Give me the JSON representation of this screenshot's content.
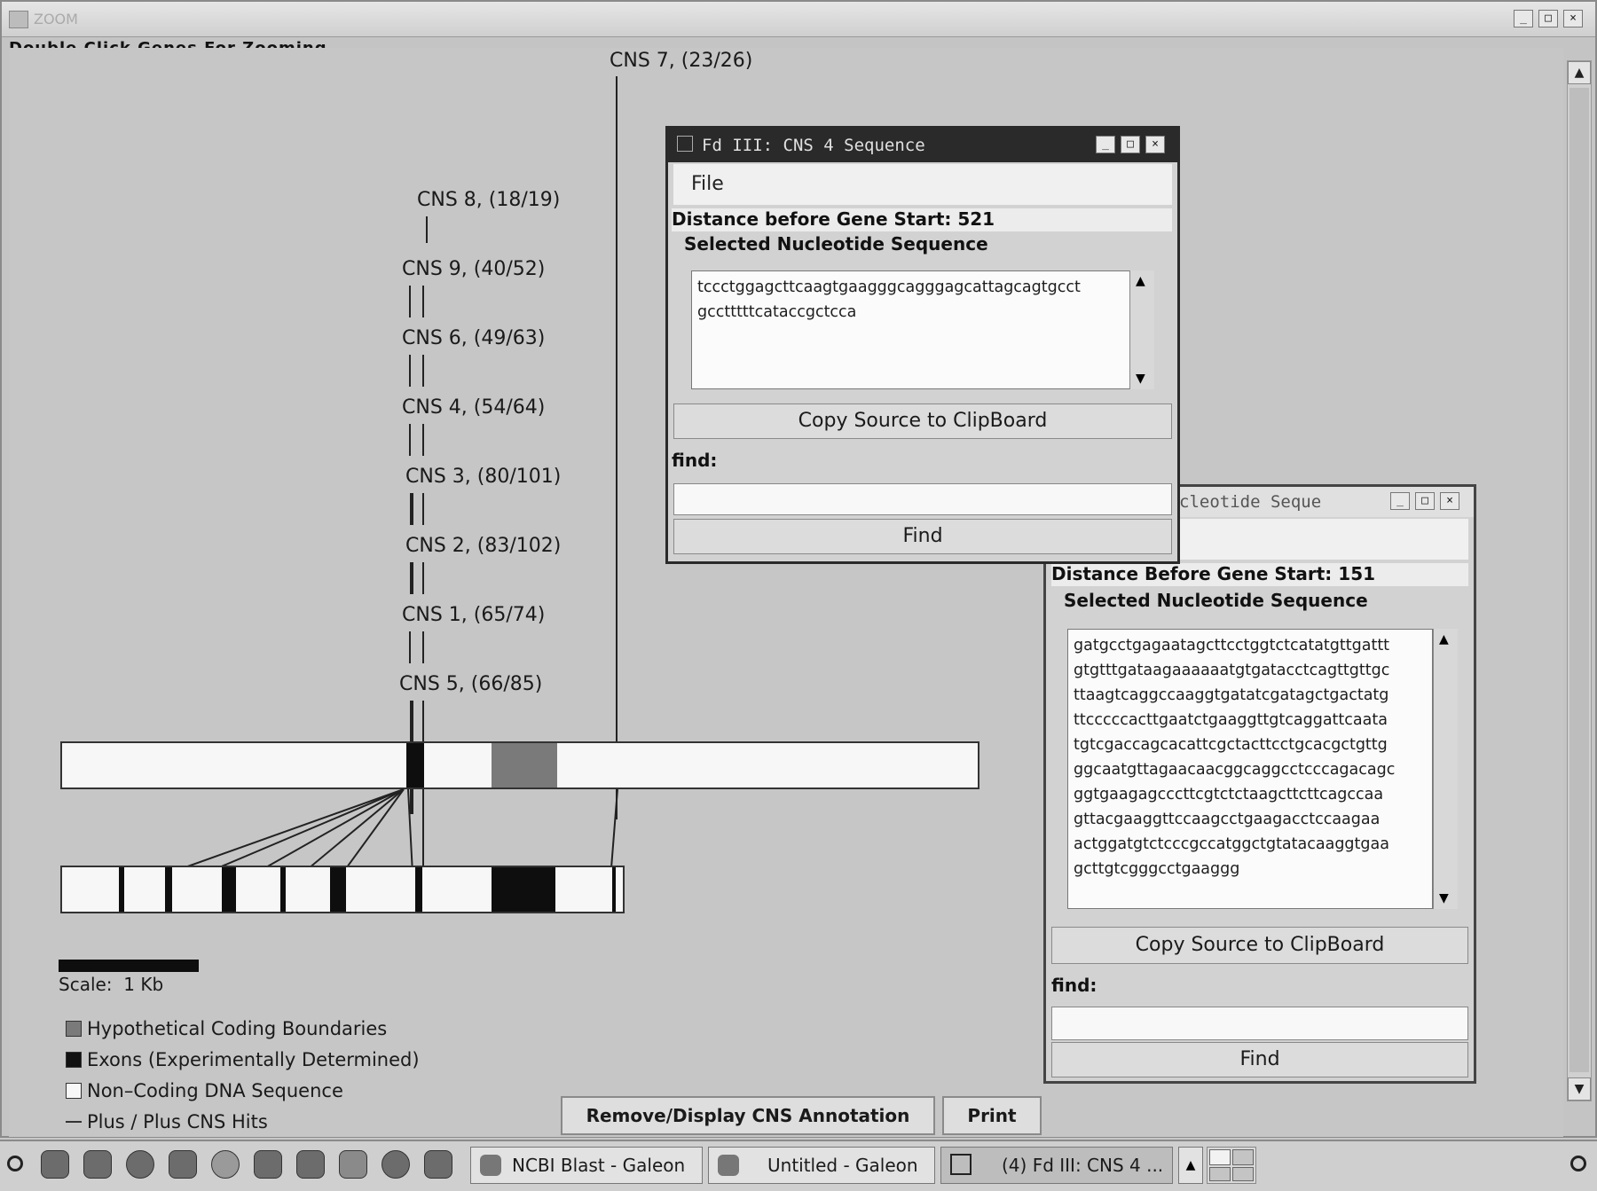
{
  "main_window": {
    "title": "ZOOM",
    "hint": "Double Click Genes For Zooming"
  },
  "cns_labels": [
    "CNS 7, (23/26)",
    "CNS 8, (18/19)",
    "CNS 9, (40/52)",
    "CNS 6, (49/63)",
    "CNS 4, (54/64)",
    "CNS 3, (80/101)",
    "CNS 2, (83/102)",
    "CNS 1, (65/74)",
    "CNS 5, (66/85)"
  ],
  "scale": {
    "label": "Scale:  1 Kb"
  },
  "legend": [
    {
      "label": "Hypothetical Coding Boundaries",
      "color": "#7a7a7a"
    },
    {
      "label": "Exons (Experimentally Determined)",
      "color": "#111111"
    },
    {
      "label": "Non–Coding DNA Sequence",
      "color": "#f7f7f7"
    },
    {
      "label": "Plus / Plus CNS Hits",
      "color": "#333333"
    }
  ],
  "buttons": {
    "remove_display": "Remove/Display CNS Annotation",
    "print": "Print"
  },
  "dialog_front": {
    "title": "Fd III: CNS 4 Sequence",
    "menu_file": "File",
    "distance": "Distance before Gene Start: 521",
    "seq_header": "Selected Nucleotide Sequence",
    "sequence": "tccctggagcttcaagtgaagggcagggagcattagcagtgcct\ngcctttttcataccgctcca",
    "copy_button": "Copy Source to ClipBoard",
    "find_label": "find:",
    "find_value": "",
    "find_button": "Find"
  },
  "dialog_back": {
    "title": "cleotide Seque",
    "distance": "Distance Before Gene Start: 151",
    "seq_header": "Selected Nucleotide Sequence",
    "sequence": "gatgcctgagaatagcttcctggtctcatatgttgattt\ngtgtttgataagaaaaaatgtgatacctcagttgttgc\nttaagtcaggccaaggtgatatcgatagctgactatg\nttcccccacttgaatctgaaggttgtcaggattcaata\ntgtcgaccagcacattcgctacttcctgcacgctgttg\nggcaatgttagaacaacggcaggcctcccagacagc\nggtgaagagcccttcgtctctaagcttcttcagccaa\ngttacgaaggttccaagcctgaagacctccaagaa\nactggatgtctcccgccatggctgtatacaaggtgaa\ngcttgtcgggcctgaaggg",
    "copy_button": "Copy Source to ClipBoard",
    "find_label": "find:",
    "find_value": "",
    "find_button": "Find"
  },
  "taskbar": {
    "tasks": [
      "NCBI Blast - Galeon",
      "Untitled - Galeon",
      "(4) Fd III: CNS 4 ..."
    ]
  }
}
